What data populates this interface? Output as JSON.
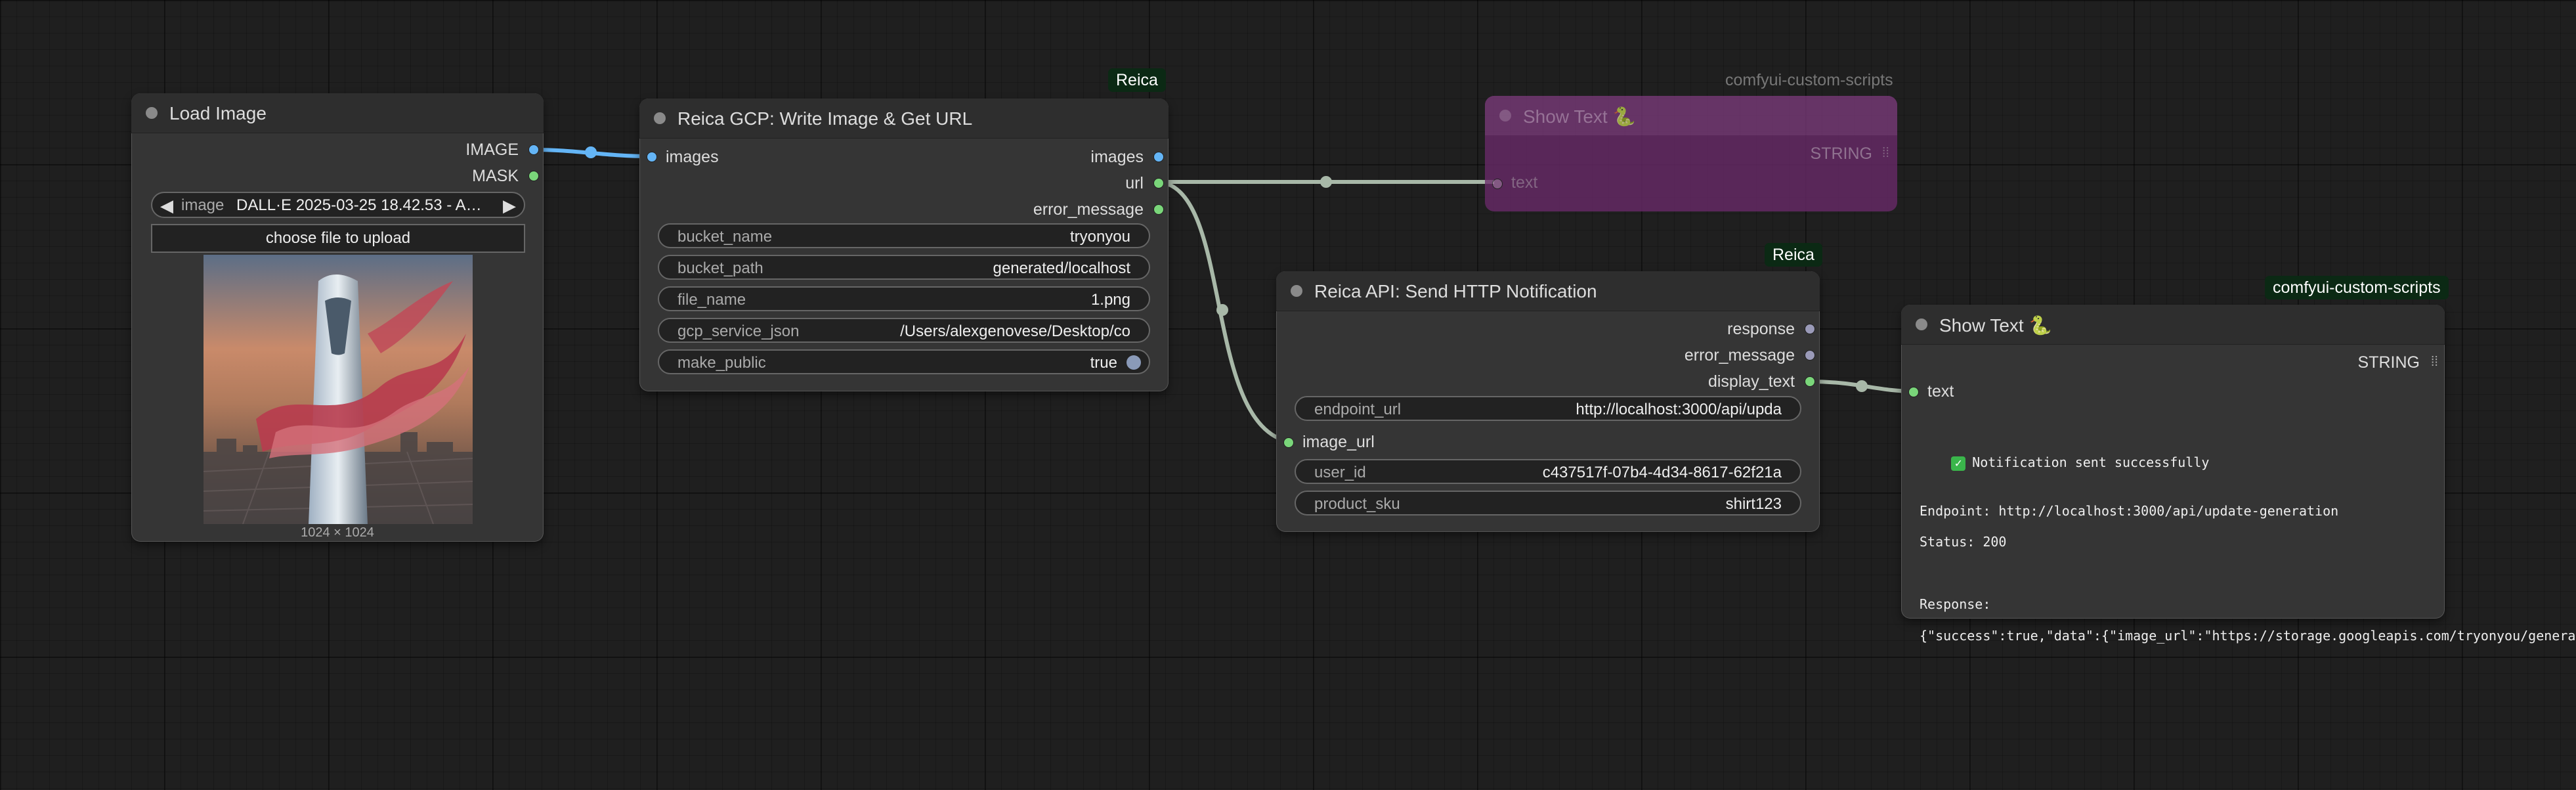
{
  "colors": {
    "canvas": "#1f1f1f",
    "node_body": "#353535",
    "badge_bg": "#0b2914",
    "image_link": "#64b5f6",
    "string_link": "#a8b8a8",
    "bypassed_node": "#6a2a6a"
  },
  "load_image": {
    "title": "Load Image",
    "outputs": [
      "IMAGE",
      "MASK"
    ],
    "image_label": "image",
    "image_value": "DALL·E 2025-03-25 18.42.53 - A…",
    "upload_label": "choose file to upload",
    "dimensions": "1024 × 1024"
  },
  "gcp_node": {
    "badge": "Reica",
    "title": "Reica GCP: Write Image & Get URL",
    "input_images": "images",
    "outputs": [
      "images",
      "url",
      "error_message"
    ],
    "widgets": [
      {
        "label": "bucket_name",
        "value": "tryonyou"
      },
      {
        "label": "bucket_path",
        "value": "generated/localhost"
      },
      {
        "label": "file_name",
        "value": "1.png"
      },
      {
        "label": "gcp_service_json",
        "value": "/Users/alexgenovese/Desktop/co"
      },
      {
        "label": "make_public",
        "value": "true"
      }
    ]
  },
  "show_text_bypassed": {
    "badge": "comfyui-custom-scripts",
    "title": "Show Text 🐍",
    "output": "STRING",
    "input": "text"
  },
  "http_node": {
    "badge": "Reica",
    "title": "Reica API: Send HTTP Notification",
    "outputs": [
      "response",
      "error_message",
      "display_text"
    ],
    "widgets": [
      {
        "label": "endpoint_url",
        "value": "http://localhost:3000/api/upda"
      }
    ],
    "input_image_url": "image_url",
    "widgets2": [
      {
        "label": "user_id",
        "value": "c437517f-07b4-4d34-8617-62f21a"
      },
      {
        "label": "product_sku",
        "value": "shirt123"
      }
    ]
  },
  "show_text": {
    "badge": "comfyui-custom-scripts",
    "title": "Show Text 🐍",
    "output": "STRING",
    "input": "text",
    "check": "✓",
    "lines": [
      "Notification sent successfully",
      "Endpoint: http://localhost:3000/api/update-generation",
      "Status: 200",
      "Response:",
      "{\"success\":true,\"data\":{\"image_url\":\"https://storage.googleapis.com/tryonyou/genera"
    ]
  }
}
